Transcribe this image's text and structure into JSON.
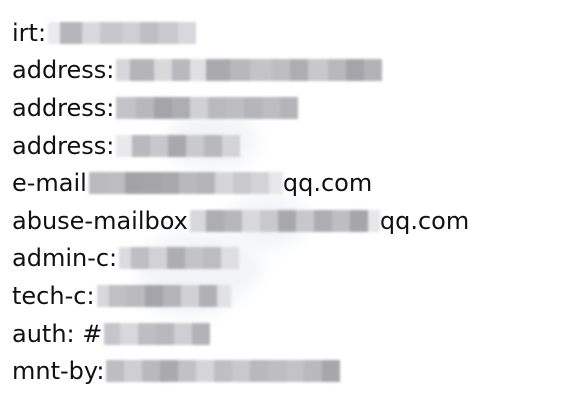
{
  "whois_record": {
    "irt_label": "irt:",
    "address_1_label": "address:",
    "address_2_label": "address:",
    "address_3_label": "address:",
    "email_label": "e-mail",
    "email_suffix": "qq.com",
    "abuse_mailbox_label": "abuse-mailbox",
    "abuse_mailbox_suffix": "qq.com",
    "admin_c_label": "admin-c:",
    "tech_c_label": "tech-c:",
    "auth_label": "auth: #",
    "mnt_by_label": "mnt-by:"
  },
  "colors": {
    "text": "#111111",
    "background": "#ffffff",
    "redaction_light": "#d8d8dc",
    "redaction_mid": "#b9b9be",
    "redaction_dark": "#a4a4aa"
  }
}
